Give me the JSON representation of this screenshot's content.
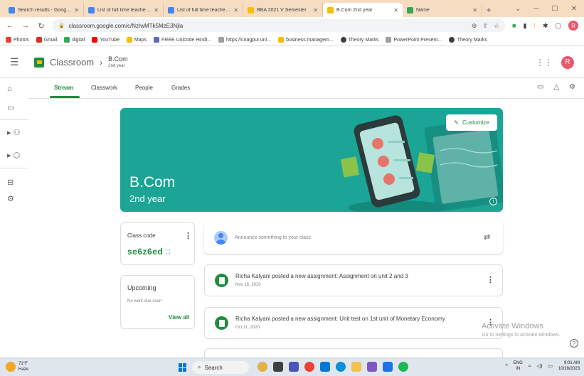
{
  "browser": {
    "tabs": [
      {
        "title": "Search results - Google Dr",
        "color": "#4285f4",
        "active": false
      },
      {
        "title": "List of full time teachers K",
        "color": "#4285f4",
        "active": false
      },
      {
        "title": "List of full time teachers K",
        "color": "#4285f4",
        "active": false
      },
      {
        "title": "BBA 2021 V Semester",
        "color": "#fbbc04",
        "active": false
      },
      {
        "title": "B.Com 2nd year",
        "color": "#fbbc04",
        "active": true
      },
      {
        "title": "Name",
        "color": "#34a853",
        "active": false
      }
    ],
    "url": "classroom.google.com/c/NzIwMTk5MzE3Njla",
    "bookmarks": [
      {
        "label": "Photos",
        "color": "#ea4335"
      },
      {
        "label": "Gmail",
        "color": "#d93025"
      },
      {
        "label": "digital",
        "color": "#34a853"
      },
      {
        "label": "YouTube",
        "color": "#ff0000"
      },
      {
        "label": "Maps",
        "color": "#fbbc04"
      },
      {
        "label": "FREE Unicode Hindi...",
        "color": "#5c6bc0"
      },
      {
        "label": "https://cnagpur.uni...",
        "color": "#9e9e9e"
      },
      {
        "label": "business managem...",
        "color": "#fbbc04"
      },
      {
        "label": "Theory Marks",
        "color": "#3c4043"
      },
      {
        "label": "PowerPoint Present...",
        "color": "#9e9e9e"
      },
      {
        "label": "Theory Marks",
        "color": "#3c4043"
      }
    ],
    "profile_initial": "R"
  },
  "header": {
    "brand": "Classroom",
    "class_name": "B.Com",
    "section": "2nd year",
    "user_initial": "R"
  },
  "nav_tabs": [
    "Stream",
    "Classwork",
    "People",
    "Grades"
  ],
  "banner": {
    "title": "B.Com",
    "subtitle": "2nd year",
    "customize_label": "Customize",
    "bg_color": "#1aa596"
  },
  "class_code": {
    "label": "Class code",
    "code": "se6z6ed"
  },
  "upcoming": {
    "title": "Upcoming",
    "empty_text": "No work due soon",
    "view_all": "View all"
  },
  "announce": {
    "placeholder": "Announce something to your class"
  },
  "posts": [
    {
      "text": "Richa Kalyani posted a new assignment: Assignment on unit 2 and 3",
      "date": "Nov 16, 2020"
    },
    {
      "text": "Richa Kalyani posted a new assignment: Unit test on 1st unit of Monetary Economy",
      "date": "Oct 11, 2020"
    }
  ],
  "watermark": {
    "line1": "Activate Windows",
    "line2": "Go to Settings to activate Windows."
  },
  "taskbar": {
    "temp": "71°F",
    "condition": "Haze",
    "search": "Search",
    "lang1": "ENG",
    "lang2": "IN",
    "time": "9:01 AM",
    "date": "10/28/2023"
  }
}
